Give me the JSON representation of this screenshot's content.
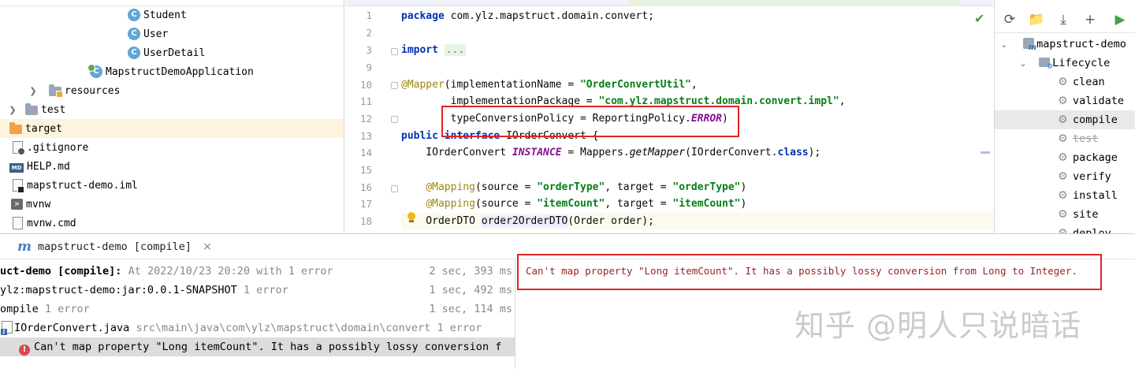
{
  "project_tree": {
    "items": [
      {
        "label": "Student",
        "icon": "class-icon"
      },
      {
        "label": "User",
        "icon": "class-icon"
      },
      {
        "label": "UserDetail",
        "icon": "class-icon"
      },
      {
        "label": "MapstructDemoApplication",
        "icon": "spring-boot-app-icon"
      },
      {
        "label": "resources",
        "icon": "resources-folder-icon"
      },
      {
        "label": "test",
        "icon": "folder-icon"
      },
      {
        "label": "target",
        "icon": "excluded-folder-icon"
      },
      {
        "label": ".gitignore",
        "icon": "gitignore-file-icon"
      },
      {
        "label": "HELP.md",
        "icon": "markdown-file-icon"
      },
      {
        "label": "mapstruct-demo.iml",
        "icon": "iml-file-icon"
      },
      {
        "label": "mvnw",
        "icon": "shell-file-icon"
      },
      {
        "label": "mvnw.cmd",
        "icon": "cmd-file-icon"
      }
    ],
    "class_badge": "C",
    "md_badge": "MD"
  },
  "editor": {
    "line_numbers": [
      "1",
      "2",
      "3",
      "9",
      "10",
      "11",
      "12",
      "13",
      "14",
      "15",
      "16",
      "17",
      "18"
    ],
    "code": {
      "l1_kw": "package",
      "l1_rest": " com.ylz.mapstruct.domain.convert;",
      "l3_kw": "import",
      "l3_fold": "...",
      "l10_an": "@Mapper",
      "l10_a": "(implementationName = ",
      "l10_s": "\"OrderConvertUtil\"",
      "l10_b": ",",
      "l11_a": "        implementationPackage = ",
      "l11_s": "\"com.ylz.mapstruct.domain.convert.impl\"",
      "l11_b": ",",
      "l12_a": "        typeConversionPolicy = ReportingPolicy.",
      "l12_it": "ERROR",
      "l12_b": ")",
      "l13_kw1": "public",
      "l13_kw2": "interface",
      "l13_rest": " IOrderConvert {",
      "l14_a": "    IOrderConvert ",
      "l14_it": "INSTANCE",
      "l14_b": " = Mappers.",
      "l14_m": "getMapper",
      "l14_c": "(IOrderConvert.",
      "l14_kw": "class",
      "l14_d": ");",
      "l16_an": "@Mapping",
      "l16_a": "(source = ",
      "l16_s1": "\"orderType\"",
      "l16_b": ", target = ",
      "l16_s2": "\"orderType\"",
      "l16_c": ")",
      "l17_an": "@Mapping",
      "l17_a": "(source = ",
      "l17_s1": "\"itemCount\"",
      "l17_b": ", target = ",
      "l17_s2": "\"itemCount\"",
      "l17_c": ")",
      "l18_a": "    OrderDTO ",
      "l18_id": "order2OrderDTO",
      "l18_b": "(Order order);"
    }
  },
  "maven": {
    "toolbar": [
      "reload-icon",
      "generate-sources-icon",
      "download-icon",
      "add-icon",
      "run-icon"
    ],
    "project": "mapstruct-demo",
    "lifecycle": "Lifecycle",
    "goals": [
      "clean",
      "validate",
      "compile",
      "test",
      "package",
      "verify",
      "install",
      "site",
      "deploy"
    ],
    "selected_goal": "compile",
    "disabled_goal": "test"
  },
  "build": {
    "tab_title": "mapstruct-demo [compile]",
    "close": "×",
    "logo": "m",
    "rows": [
      {
        "name": "uct-demo [compile]:",
        "detail": " At 2022/10/23 20:20 with 1 error",
        "time": "2 sec, 393 ms"
      },
      {
        "name": "ylz:mapstruct-demo:jar:0.0.1-SNAPSHOT",
        "detail": "  1 error",
        "time": "1 sec, 492 ms"
      },
      {
        "name": "ompile",
        "detail": "  1 error",
        "time": "1 sec, 114 ms"
      },
      {
        "name": "IOrderConvert.java",
        "detail": " src\\main\\java\\com\\ylz\\mapstruct\\domain\\convert 1 error",
        "time": ""
      },
      {
        "name": "Can't map property \"Long itemCount\". It has a possibly lossy conversion f",
        "detail": "",
        "time": ""
      }
    ],
    "error_badge": "!",
    "console_message": "Can't map property \"Long itemCount\". It has a possibly lossy conversion from Long to Integer."
  },
  "watermark": "知乎 @明人只说暗话"
}
